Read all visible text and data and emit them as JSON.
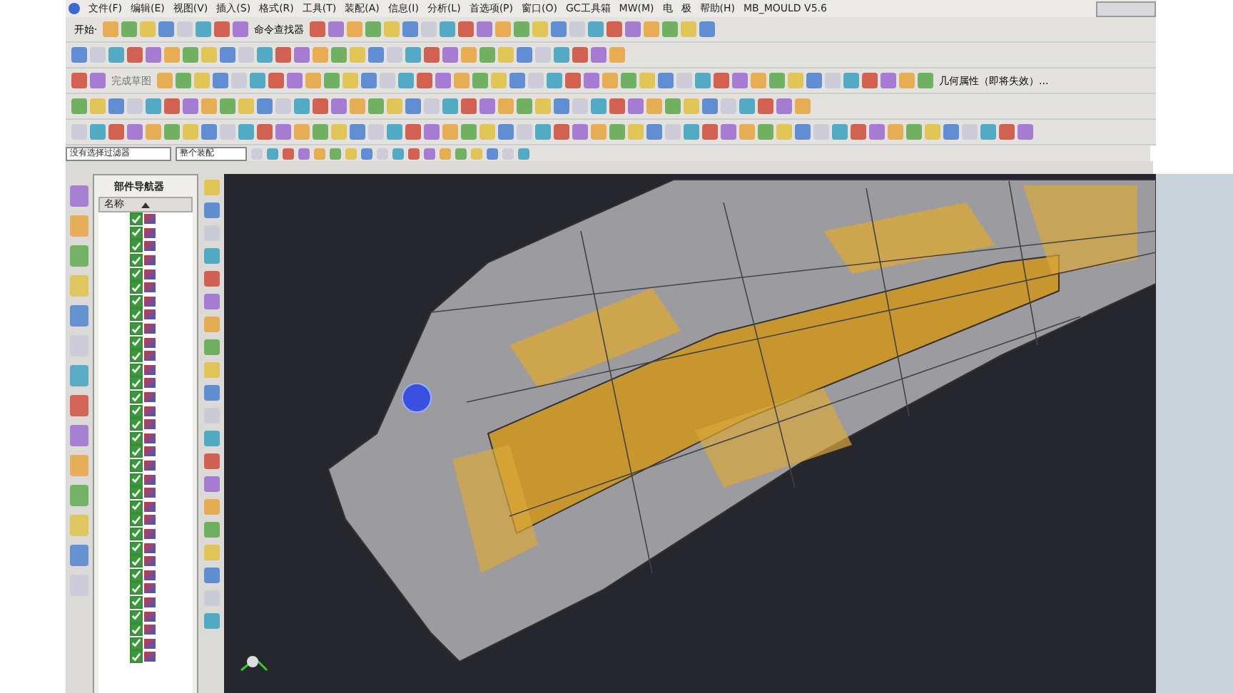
{
  "menu": [
    "文件(F)",
    "编辑(E)",
    "视图(V)",
    "插入(S)",
    "格式(R)",
    "工具(T)",
    "装配(A)",
    "信息(I)",
    "分析(L)",
    "首选项(P)",
    "窗口(O)",
    "GC工具箱",
    "MW(M)",
    "电",
    "极",
    "帮助(H)",
    "MB_MOULD V5.6"
  ],
  "toolbar": {
    "start_button": "开始·",
    "command_finder": "命令查找器",
    "finish_sketch": "完成草图",
    "geometry_properties": "几何属性（即将失效）..."
  },
  "filter_bar": {
    "selection_filter": "没有选择过滤器",
    "scope": "整个装配"
  },
  "navigator": {
    "title": "部件导航器",
    "column": "名称",
    "rows": [
      {
        "checked": true
      },
      {
        "checked": true
      },
      {
        "checked": true
      },
      {
        "checked": true
      },
      {
        "checked": true
      },
      {
        "checked": true
      },
      {
        "checked": true
      },
      {
        "checked": true
      },
      {
        "checked": true
      },
      {
        "checked": true
      },
      {
        "checked": true
      },
      {
        "checked": true
      },
      {
        "checked": true
      },
      {
        "checked": true
      },
      {
        "checked": true
      },
      {
        "checked": true
      },
      {
        "checked": true
      },
      {
        "checked": true
      },
      {
        "checked": true
      },
      {
        "checked": true
      },
      {
        "checked": true
      },
      {
        "checked": true
      },
      {
        "checked": true
      },
      {
        "checked": true
      },
      {
        "checked": true
      },
      {
        "checked": true
      },
      {
        "checked": true
      },
      {
        "checked": true
      },
      {
        "checked": true
      },
      {
        "checked": true
      },
      {
        "checked": true
      },
      {
        "checked": true
      },
      {
        "checked": true
      }
    ]
  }
}
